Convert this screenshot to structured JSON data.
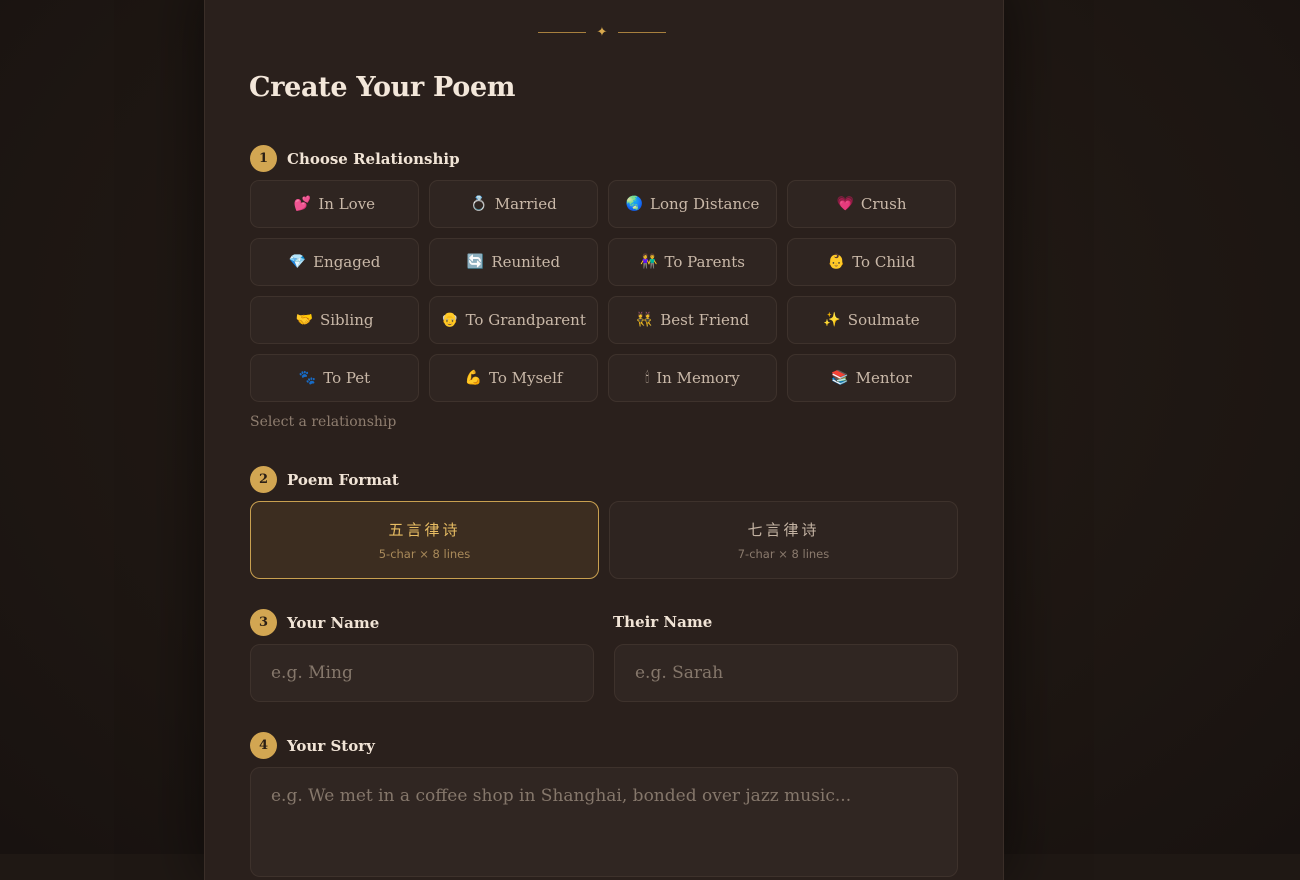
{
  "ornament": {
    "symbol": "✦"
  },
  "page_title": "Create Your Poem",
  "steps": {
    "relationship": {
      "number": "1",
      "label": "Choose Relationship"
    },
    "format": {
      "number": "2",
      "label": "Poem Format"
    },
    "names": {
      "number": "3",
      "your_label": "Your Name",
      "their_label": "Their Name"
    },
    "story": {
      "number": "4",
      "label": "Your Story"
    }
  },
  "relationships": [
    {
      "emoji": "💕",
      "label": "In Love",
      "icon": "two-hearts-icon"
    },
    {
      "emoji": "💍",
      "label": "Married",
      "icon": "ring-icon"
    },
    {
      "emoji": "🌏",
      "label": "Long Distance",
      "icon": "globe-icon"
    },
    {
      "emoji": "💗",
      "label": "Crush",
      "icon": "growing-heart-icon"
    },
    {
      "emoji": "💎",
      "label": "Engaged",
      "icon": "gem-icon"
    },
    {
      "emoji": "🔄",
      "label": "Reunited",
      "icon": "arrows-cycle-icon"
    },
    {
      "emoji": "👫",
      "label": "To Parents",
      "icon": "couple-icon"
    },
    {
      "emoji": "👶",
      "label": "To Child",
      "icon": "baby-icon"
    },
    {
      "emoji": "🤝",
      "label": "Sibling",
      "icon": "handshake-icon"
    },
    {
      "emoji": "👴",
      "label": "To Grandparent",
      "icon": "old-man-icon"
    },
    {
      "emoji": "👯",
      "label": "Best Friend",
      "icon": "friends-icon"
    },
    {
      "emoji": "✨",
      "label": "Soulmate",
      "icon": "sparkles-icon"
    },
    {
      "emoji": "🐾",
      "label": "To Pet",
      "icon": "paw-prints-icon"
    },
    {
      "emoji": "💪",
      "label": "To Myself",
      "icon": "flexed-arm-icon"
    },
    {
      "emoji": "🕯",
      "label": "In Memory",
      "icon": "candle-icon"
    },
    {
      "emoji": "📚",
      "label": "Mentor",
      "icon": "books-icon"
    }
  ],
  "relationship_hint": "Select a relationship",
  "formats": [
    {
      "name": "五言律诗",
      "sub": "5-char × 8 lines",
      "selected": true
    },
    {
      "name": "七言律诗",
      "sub": "7-char × 8 lines",
      "selected": false
    }
  ],
  "inputs": {
    "your_name": {
      "placeholder": "e.g. Ming",
      "value": ""
    },
    "their_name": {
      "placeholder": "e.g. Sarah",
      "value": ""
    },
    "story": {
      "placeholder": "e.g. We met in a coffee shop in Shanghai, bonded over jazz music...",
      "value": ""
    }
  },
  "colors": {
    "accent": "#d2a652",
    "background": "#1f1814",
    "card": "#2a201c"
  }
}
